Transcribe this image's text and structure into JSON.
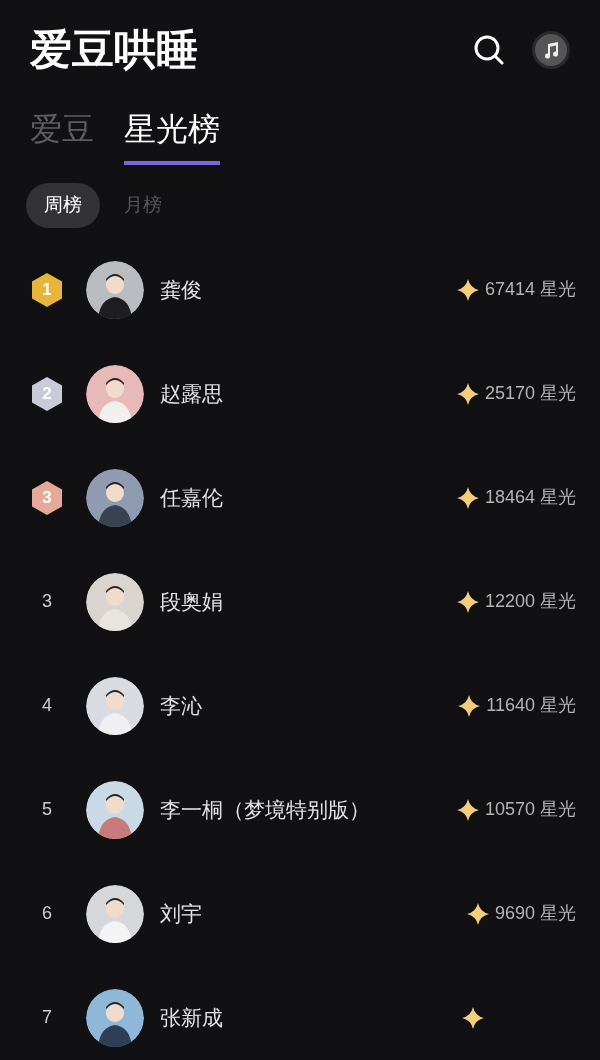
{
  "app_title": "爱豆哄睡",
  "tabs": [
    {
      "label": "爱豆",
      "selected": false
    },
    {
      "label": "星光榜",
      "selected": true
    }
  ],
  "periods": [
    {
      "label": "周榜",
      "selected": true
    },
    {
      "label": "月榜",
      "selected": false
    }
  ],
  "rows": [
    {
      "rank": "1",
      "kind": "medal",
      "color": "#e8b53c",
      "name": "龚俊",
      "score": "67414 星光"
    },
    {
      "rank": "2",
      "kind": "medal",
      "color": "#c9ccd8",
      "name": "赵露思",
      "score": "25170 星光"
    },
    {
      "rank": "3",
      "kind": "medal",
      "color": "#e6a898",
      "name": "任嘉伦",
      "score": "18464 星光"
    },
    {
      "rank": "3",
      "kind": "number",
      "name": "段奥娟",
      "score": "12200 星光"
    },
    {
      "rank": "4",
      "kind": "number",
      "name": "李沁",
      "score": "11640 星光"
    },
    {
      "rank": "5",
      "kind": "number",
      "name": "李一桐（梦境特别版）",
      "score": "10570 星光"
    },
    {
      "rank": "6",
      "kind": "number",
      "name": "刘宇",
      "score": "9690 星光"
    },
    {
      "rank": "7",
      "kind": "number",
      "name": "张新成"
    }
  ]
}
